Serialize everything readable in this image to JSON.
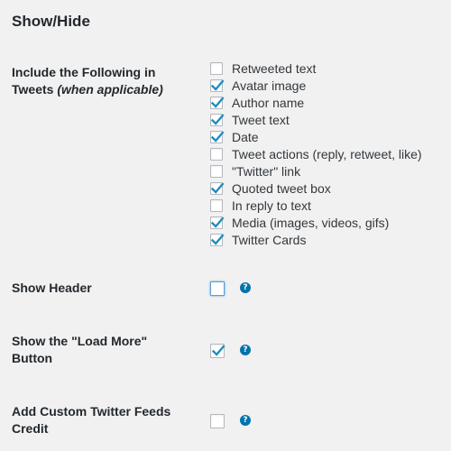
{
  "section_title": "Show/Hide",
  "include_label": "Include the Following in Tweets",
  "include_label_note": "(when applicable)",
  "include_options": [
    {
      "label": "Retweeted text",
      "checked": false
    },
    {
      "label": "Avatar image",
      "checked": true
    },
    {
      "label": "Author name",
      "checked": true
    },
    {
      "label": "Tweet text",
      "checked": true
    },
    {
      "label": "Date",
      "checked": true
    },
    {
      "label": "Tweet actions (reply, retweet, like)",
      "checked": false
    },
    {
      "label": "\"Twitter\" link",
      "checked": false
    },
    {
      "label": "Quoted tweet box",
      "checked": true
    },
    {
      "label": "In reply to text",
      "checked": false
    },
    {
      "label": "Media (images, videos, gifs)",
      "checked": true
    },
    {
      "label": "Twitter Cards",
      "checked": true
    }
  ],
  "show_header": {
    "label": "Show Header",
    "checked": false,
    "help_icon": "question-circle-icon"
  },
  "show_load_more": {
    "label": "Show the \"Load More\" Button",
    "checked": true,
    "help_icon": "question-circle-icon"
  },
  "add_credit": {
    "label": "Add Custom Twitter Feeds Credit",
    "checked": false,
    "help_icon": "question-circle-icon"
  },
  "colors": {
    "check": "#1e8cbe",
    "help": "#0073aa"
  }
}
